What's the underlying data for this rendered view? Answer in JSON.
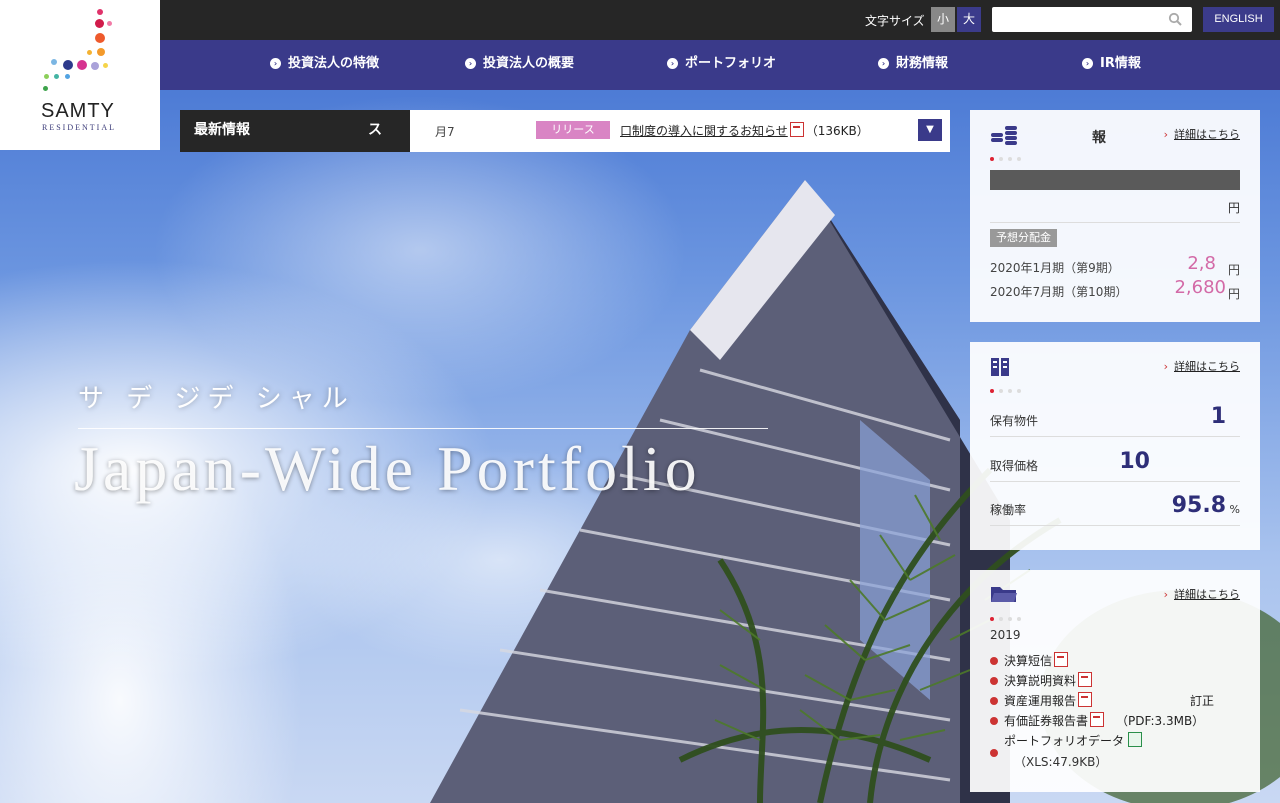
{
  "logo": {
    "name": "SAMTY",
    "sub": "RESIDENTIAL"
  },
  "topbar": {
    "font_size_label": "文字サイズ",
    "font_small": "小",
    "font_large": "大",
    "search_placeholder": "",
    "language_button": "ENGLISH"
  },
  "nav": {
    "items": [
      {
        "label": "投資法人の特徴"
      },
      {
        "label": "投資法人の概要"
      },
      {
        "label": "ポートフォリオ"
      },
      {
        "label": "財務情報"
      },
      {
        "label": "IR情報"
      }
    ]
  },
  "news": {
    "title": "最新情報",
    "title_suffix": "ス",
    "date": "月7",
    "tag": "リリース",
    "text": "口制度の導入に関するお知らせ",
    "size": "（136KB）"
  },
  "hero": {
    "jp": "サ デ ジデ シャル",
    "en": "Japan-Wide Portfolio"
  },
  "panels": {
    "dividend": {
      "title": "報",
      "link": "詳細はこちら",
      "band_right": "円",
      "tag": "予想分配金",
      "rows": [
        {
          "label": "2020年1月期（第9期）",
          "amount": "2,8",
          "unit": "円"
        },
        {
          "label": "2020年7月期（第10期）",
          "amount": "2,680",
          "unit": "円"
        }
      ]
    },
    "portfolio": {
      "title": "",
      "link": "詳細はこちら",
      "rows": [
        {
          "label": "保有物件",
          "value": "1",
          "unit": ""
        },
        {
          "label": "取得価格",
          "value": "10",
          "unit": ""
        },
        {
          "label": "稼働率",
          "value": "95.8",
          "unit": "%"
        }
      ]
    },
    "ir": {
      "title": "",
      "link": "詳細はこちら",
      "period": "2019",
      "items": [
        {
          "label": "決算短信",
          "meta": ""
        },
        {
          "label": "決算説明資料",
          "meta": ""
        },
        {
          "label": "資産運用報告",
          "meta": "訂正"
        },
        {
          "label": "有価証券報告書",
          "meta": "（PDF:3.3MB）"
        },
        {
          "label": "ポートフォリオデータ",
          "meta": "（XLS:47.9KB）"
        }
      ]
    }
  },
  "colors": {
    "nav": "#3a3a8a",
    "topbar": "#262626",
    "accent_pink": "#d36aa7",
    "accent_red": "#cc3333"
  }
}
